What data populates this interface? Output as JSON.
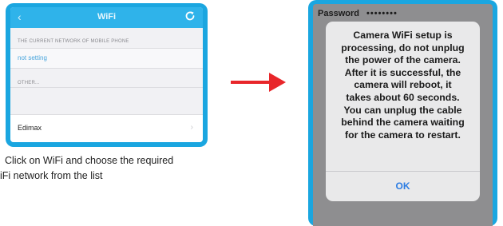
{
  "left_screen": {
    "nav": {
      "back_icon": "chevron-left-icon",
      "title": "WiFi",
      "refresh_icon": "refresh-icon"
    },
    "current_header": "THE CURRENT NETWORK OF MOBILE PHONE",
    "current_value": "not setting",
    "other_header": "OTHER...",
    "networks": [
      {
        "name": "Edimax",
        "chevron": "›"
      }
    ]
  },
  "caption": {
    "line1": "Click on WiFi and choose the required",
    "line2": "iFi network from the list"
  },
  "arrow": {
    "icon": "right-arrow-icon",
    "color": "#e8262a"
  },
  "right_screen": {
    "password_label": "Password",
    "password_value": "••••••••",
    "dialog": {
      "message": "Camera WiFi setup is\nprocessing, do not unplug\nthe power of the camera.\nAfter it is successful, the\ncamera will reboot, it\ntakes about 60 seconds.\nYou can unplug the cable\nbehind the camera waiting\nfor the camera to restart.",
      "ok_label": "OK"
    }
  },
  "colors": {
    "frame_blue": "#1aa6e0",
    "nav_blue": "#2fb3ea",
    "link_blue": "#4aa6dd",
    "ok_blue": "#2d7de3",
    "arrow_red": "#e8262a"
  }
}
